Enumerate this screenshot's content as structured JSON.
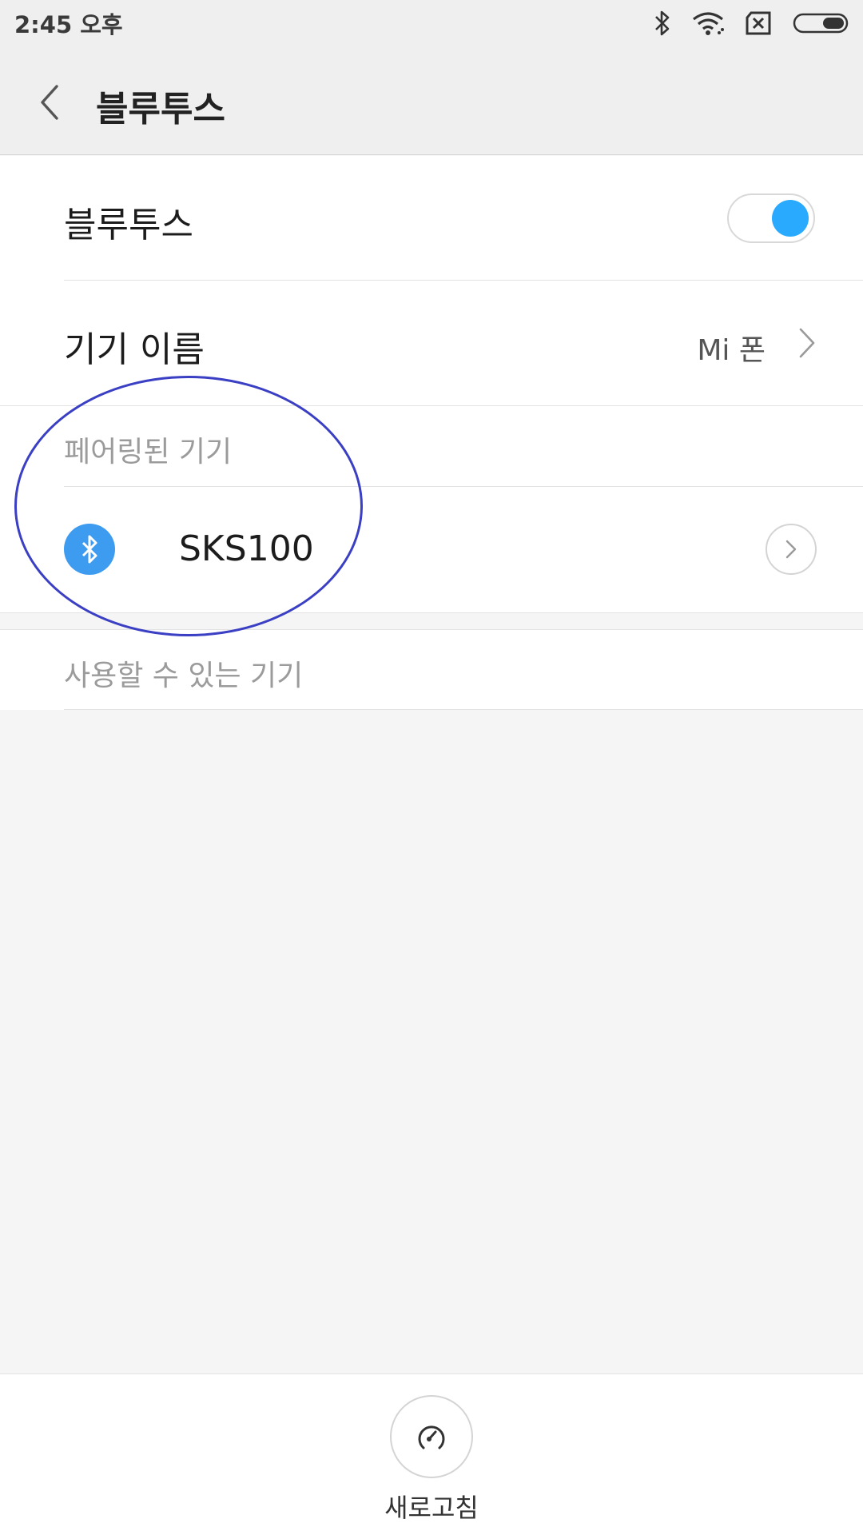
{
  "status_bar": {
    "time": "2:45 오후",
    "icons": [
      "bluetooth-icon",
      "wifi-icon",
      "no-sim-icon",
      "battery-icon"
    ]
  },
  "header": {
    "title": "블루투스"
  },
  "bluetooth_toggle": {
    "label": "블루투스",
    "enabled": true,
    "accent": "#29aaff"
  },
  "device_name_row": {
    "label": "기기 이름",
    "value": "Mi 폰"
  },
  "paired_section": {
    "header": "페어링된 기기",
    "devices": [
      {
        "name": "SKS100",
        "icon": "bluetooth-icon"
      }
    ]
  },
  "available_section": {
    "header": "사용할 수 있는 기기"
  },
  "bottom": {
    "refresh_label": "새로고침"
  },
  "annotation": {
    "color": "#3a3fc4"
  }
}
